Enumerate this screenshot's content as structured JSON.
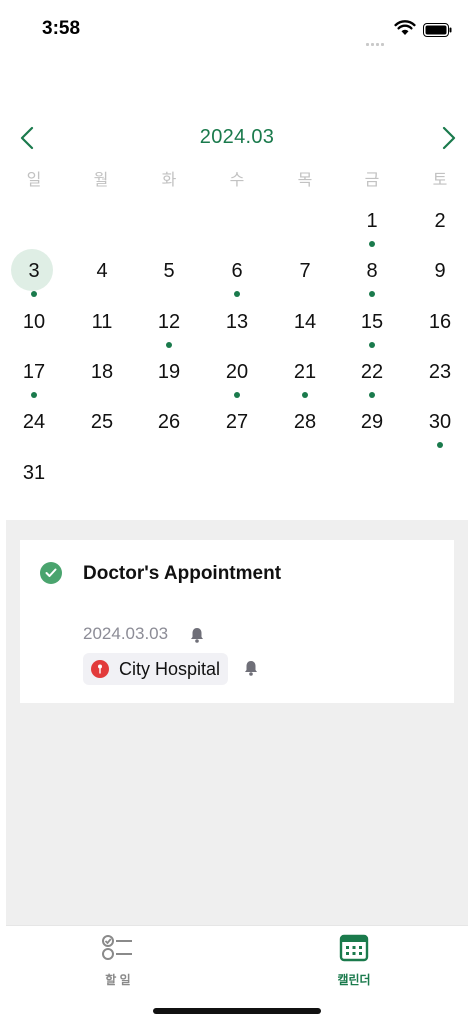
{
  "status_bar": {
    "time": "3:58"
  },
  "calendar": {
    "month_title": "2024.03",
    "weekdays": [
      "일",
      "월",
      "화",
      "수",
      "목",
      "금",
      "토"
    ],
    "days": [
      {
        "d": "1",
        "dot": true
      },
      {
        "d": "2",
        "dot": false
      },
      {
        "d": "3",
        "dot": true,
        "selected": true
      },
      {
        "d": "4",
        "dot": false
      },
      {
        "d": "5",
        "dot": false
      },
      {
        "d": "6",
        "dot": true
      },
      {
        "d": "7",
        "dot": false
      },
      {
        "d": "8",
        "dot": true
      },
      {
        "d": "9",
        "dot": false
      },
      {
        "d": "10",
        "dot": false
      },
      {
        "d": "11",
        "dot": false
      },
      {
        "d": "12",
        "dot": true
      },
      {
        "d": "13",
        "dot": false
      },
      {
        "d": "14",
        "dot": false
      },
      {
        "d": "15",
        "dot": true
      },
      {
        "d": "16",
        "dot": false
      },
      {
        "d": "17",
        "dot": true
      },
      {
        "d": "18",
        "dot": false
      },
      {
        "d": "19",
        "dot": false
      },
      {
        "d": "20",
        "dot": true
      },
      {
        "d": "21",
        "dot": true
      },
      {
        "d": "22",
        "dot": true
      },
      {
        "d": "23",
        "dot": false
      },
      {
        "d": "24",
        "dot": false
      },
      {
        "d": "25",
        "dot": false
      },
      {
        "d": "26",
        "dot": false
      },
      {
        "d": "27",
        "dot": false
      },
      {
        "d": "28",
        "dot": false
      },
      {
        "d": "29",
        "dot": false
      },
      {
        "d": "30",
        "dot": true
      },
      {
        "d": "31",
        "dot": false
      }
    ],
    "first_weekday_index": 5
  },
  "event": {
    "title": "Doctor's Appointment",
    "date": "2024.03.03",
    "location": "City Hospital",
    "completed": true
  },
  "tabs": [
    {
      "label": "할 일",
      "icon": "todo-list-icon",
      "active": false
    },
    {
      "label": "캘린더",
      "icon": "calendar-icon",
      "active": true
    }
  ],
  "colors": {
    "accent": "#1a7a4c",
    "check": "#4aa46e",
    "pin": "#e23b3b",
    "muted": "#8c8c96"
  }
}
